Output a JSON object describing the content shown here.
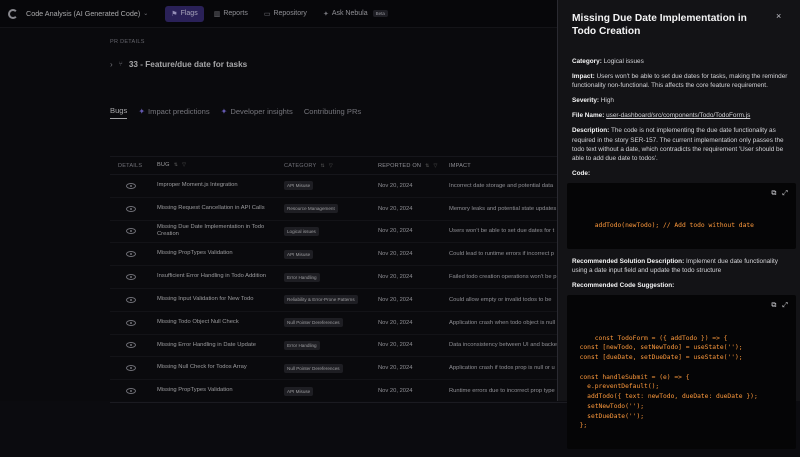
{
  "topbar": {
    "project": "Code Analysis (AI Generated Code)",
    "nav": [
      {
        "label": "Flags",
        "icon": "flag-icon",
        "active": true
      },
      {
        "label": "Reports",
        "icon": "chart-icon",
        "active": false
      },
      {
        "label": "Repository",
        "icon": "folder-icon",
        "active": false
      },
      {
        "label": "Ask Nebula",
        "icon": "sparkle-icon",
        "active": false
      }
    ],
    "beta": "Beta"
  },
  "main": {
    "section_label": "PR DETAILS",
    "pr_title": "33 - Feature/due date for tasks",
    "tabs": [
      "Bugs",
      "Impact predictions",
      "Developer insights",
      "Contributing PRs"
    ],
    "columns": [
      "DETAILS",
      "BUG",
      "CATEGORY",
      "REPORTED ON",
      "IMPACT"
    ],
    "rows": [
      {
        "bug": "Improper Moment.js Integration",
        "category": "API Misuse",
        "date": "Nov 20, 2024",
        "impact": "Incorrect date storage and potential data"
      },
      {
        "bug": "Missing Request Cancellation in API Calls",
        "category": "Resource Management",
        "date": "Nov 20, 2024",
        "impact": "Memory leaks and potential state updates"
      },
      {
        "bug": "Missing Due Date Implementation in Todo Creation",
        "category": "Logical issues",
        "date": "Nov 20, 2024",
        "impact": "Users won't be able to set due dates for t"
      },
      {
        "bug": "Missing PropTypes Validation",
        "category": "API Misuse",
        "date": "Nov 20, 2024",
        "impact": "Could lead to runtime errors if incorrect p"
      },
      {
        "bug": "Insufficient Error Handling in Todo Addition",
        "category": "Error Handling",
        "date": "Nov 20, 2024",
        "impact": "Failed todo creation operations won't be p"
      },
      {
        "bug": "Missing Input Validation for New Todo",
        "category": "Reliability & Error-Prone Patterns",
        "date": "Nov 20, 2024",
        "impact": "Could allow empty or invalid todos to be"
      },
      {
        "bug": "Missing Todo Object Null Check",
        "category": "Null Pointer Dereferences",
        "date": "Nov 20, 2024",
        "impact": "Application crash when todo object is null"
      },
      {
        "bug": "Missing Error Handling in Date Update",
        "category": "Error Handling",
        "date": "Nov 20, 2024",
        "impact": "Data inconsistency between UI and backe"
      },
      {
        "bug": "Missing Null Check for Todos Array",
        "category": "Null Pointer Dereferences",
        "date": "Nov 20, 2024",
        "impact": "Application crash if todos prop is null or u"
      },
      {
        "bug": "Missing PropTypes Validation",
        "category": "API Misuse",
        "date": "Nov 20, 2024",
        "impact": "Runtime errors due to incorrect prop type"
      }
    ]
  },
  "panel": {
    "title": "Missing Due Date Implementation in Todo Creation",
    "category_label": "Category:",
    "category": "Logical issues",
    "impact_label": "Impact:",
    "impact": "Users won't be able to set due dates for tasks, making the reminder functionality non-functional. This affects the core feature requirement.",
    "severity_label": "Severity:",
    "severity": "High",
    "file_label": "File Name:",
    "file": "user-dashboard/src/components/Todo/TodoForm.js",
    "description_label": "Description:",
    "description": "The code is not implementing the due date functionality as required in the story SER-157. The current implementation only passes the todo text without a date, which contradicts the requirement 'User should be able to add due date to todos'.",
    "code_label": "Code:",
    "code": "addTodo(newTodo); // Add todo without date",
    "rec_desc_label": "Recommended Solution Description:",
    "rec_desc": "Implement due date functionality using a date input field and update the todo structure",
    "rec_code_label": "Recommended Code Suggestion:",
    "rec_code": "const TodoForm = ({ addTodo }) => {\n  const [newTodo, setNewTodo] = useState('');\n  const [dueDate, setDueDate] = useState('');\n\n  const handleSubmit = (e) => {\n    e.preventDefault();\n    addTodo({ text: newTodo, dueDate: dueDate });\n    setNewTodo('');\n    setDueDate('');\n  };",
    "close": "×"
  }
}
